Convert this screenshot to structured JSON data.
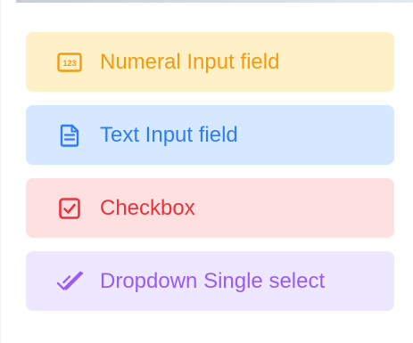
{
  "field_types": [
    {
      "key": "numeral",
      "label": "Numeral Input field",
      "icon": "numeral-123-icon",
      "color": "#f29a12",
      "background": "#fff1c7"
    },
    {
      "key": "text",
      "label": "Text Input field",
      "icon": "document-text-icon",
      "color": "#2f7df0",
      "background": "#d6e8ff"
    },
    {
      "key": "checkbox",
      "label": "Checkbox",
      "icon": "checkbox-checked-icon",
      "color": "#e8323c",
      "background": "#ffe0e0"
    },
    {
      "key": "dropdown",
      "label": "Dropdown Single select",
      "icon": "double-check-icon",
      "color": "#9a5cf0",
      "background": "#ede7ff"
    }
  ]
}
